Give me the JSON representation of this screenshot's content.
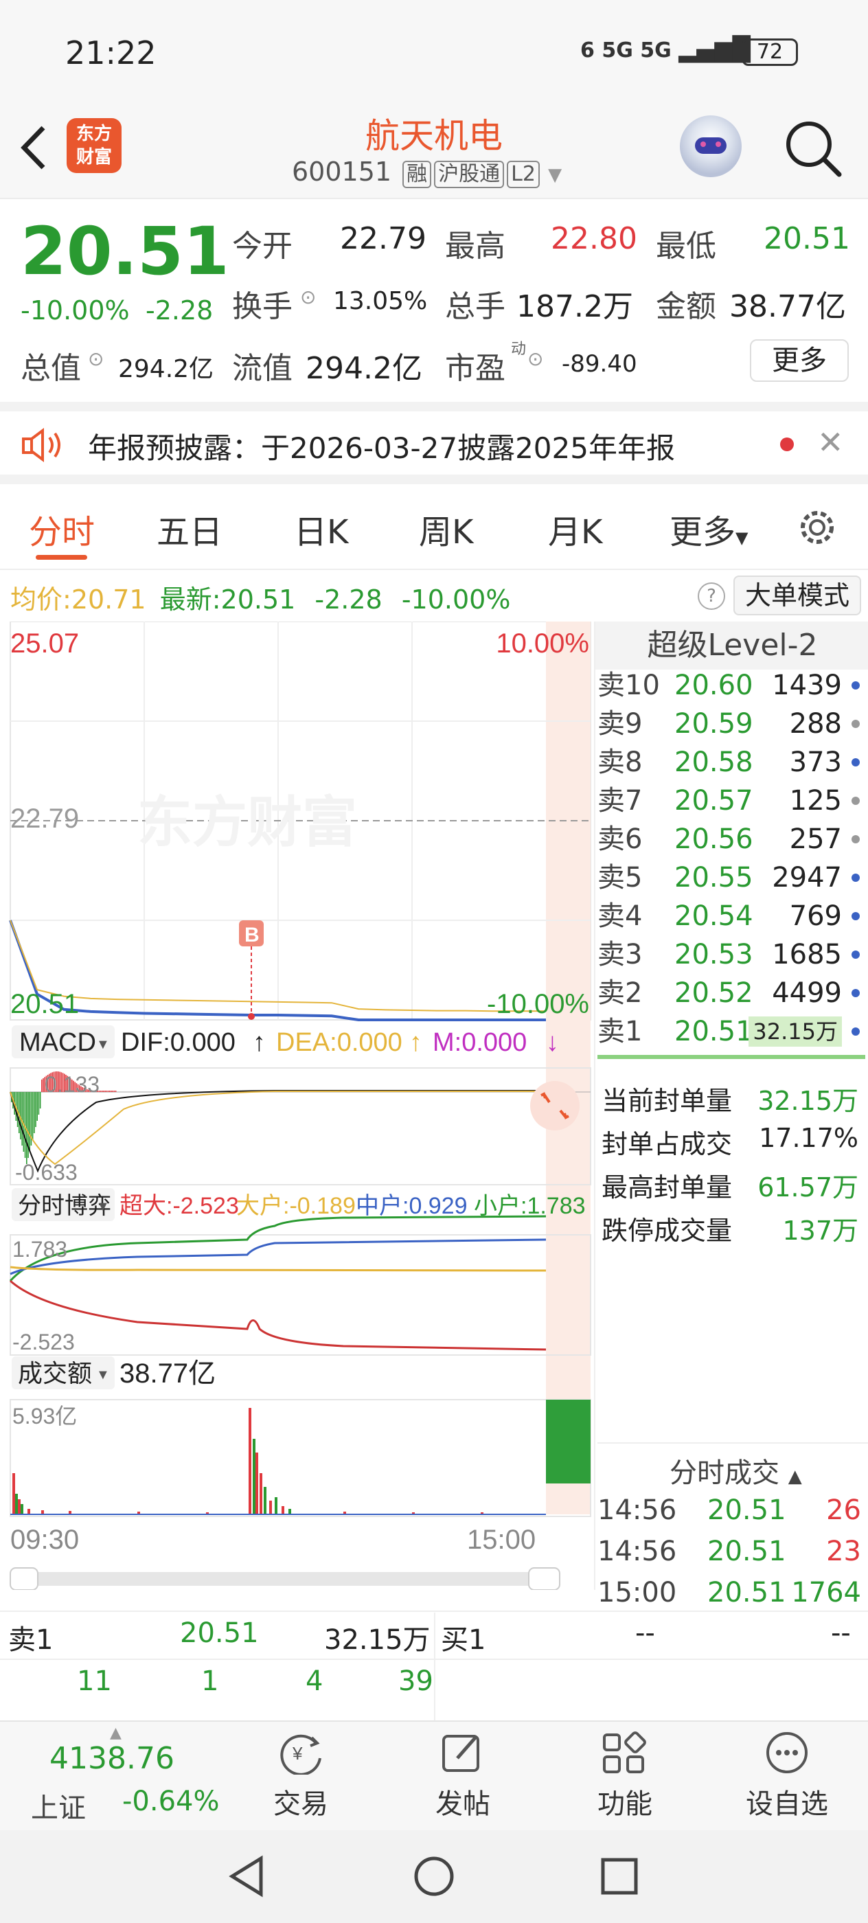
{
  "status": {
    "time": "21:22",
    "signal": "6 5G 5G",
    "battery": "72"
  },
  "header": {
    "title": "航天机电",
    "code": "600151",
    "tags": [
      "融",
      "沪股通",
      "L2"
    ]
  },
  "quote": {
    "price": "20.51",
    "pct": "-10.00%",
    "change": "-2.28",
    "open_label": "今开",
    "open": "22.79",
    "high_label": "最高",
    "high": "22.80",
    "low_label": "最低",
    "low": "20.51",
    "turnover_label": "换手",
    "turnover": "13.05%",
    "volume_label": "总手",
    "volume": "187.2万",
    "amount_label": "金额",
    "amount": "38.77亿",
    "mktcap_label": "总值",
    "mktcap": "294.2亿",
    "float_label": "流值",
    "float": "294.2亿",
    "pe_label": "市盈",
    "pe_sup": "动",
    "pe": "-89.40",
    "more_button": "更多"
  },
  "notice": {
    "text": "年报预披露：于2026-03-27披露2025年年报"
  },
  "tabs": [
    "分时",
    "五日",
    "日K",
    "周K",
    "月K",
    "更多"
  ],
  "chart_info": {
    "avg_label": "均价:",
    "avg": "20.71",
    "last_label": "最新:",
    "last": "20.51",
    "chg": "-2.28",
    "pct": "-10.00%",
    "mode_button": "大单模式"
  },
  "chart_data": [
    {
      "type": "line",
      "title": "",
      "y_top_label": "25.07",
      "y_ref_label": "22.79",
      "y_bottom_label": "20.51",
      "pct_top_label": "10.00%",
      "pct_bottom_label": "-10.00%",
      "ylim": [
        20.51,
        25.07
      ],
      "series": [
        {
          "values": [
            22.79,
            21.1,
            20.75,
            20.7,
            20.68,
            20.66,
            20.65,
            20.64,
            20.63,
            20.62,
            20.62,
            20.61,
            20.6,
            20.51,
            20.51,
            20.51,
            20.51,
            20.51,
            20.51,
            20.51,
            20.51
          ]
        },
        {
          "values": [
            22.79,
            21.2,
            21.05,
            21.0,
            20.98,
            20.97,
            20.96,
            20.95,
            20.94,
            20.93,
            20.92,
            20.91,
            20.9,
            20.76,
            20.74,
            20.73,
            20.72,
            20.72,
            20.71,
            20.71,
            20.71
          ]
        }
      ],
      "marker": "B",
      "xlabels": [
        "09:30",
        "15:00"
      ]
    },
    {
      "type": "bar",
      "title": "MACD",
      "dif_label": "DIF:0.000",
      "dea_label": "DEA:0.000",
      "m_label": "M:0.000",
      "y_top_label": "0.133",
      "y_bottom_label": "-0.633"
    },
    {
      "type": "line",
      "title": "分时博弈",
      "labels": [
        "超大:-2.523",
        "大户:-0.189",
        "中户:0.929",
        "小户:1.783"
      ],
      "y_top_label": "1.783",
      "y_bottom_label": "-2.523"
    },
    {
      "type": "bar",
      "title": "成交额",
      "total": "38.77亿",
      "y_top_label": "5.93亿",
      "xlabels": [
        "09:30",
        "15:00"
      ]
    }
  ],
  "level2": {
    "title": "超级Level-2",
    "asks": [
      {
        "label": "卖10",
        "price": "20.60",
        "vol": "1439"
      },
      {
        "label": "卖9",
        "price": "20.59",
        "vol": "288"
      },
      {
        "label": "卖8",
        "price": "20.58",
        "vol": "373"
      },
      {
        "label": "卖7",
        "price": "20.57",
        "vol": "125"
      },
      {
        "label": "卖6",
        "price": "20.56",
        "vol": "257"
      },
      {
        "label": "卖5",
        "price": "20.55",
        "vol": "2947"
      },
      {
        "label": "卖4",
        "price": "20.54",
        "vol": "769"
      },
      {
        "label": "卖3",
        "price": "20.53",
        "vol": "1685"
      },
      {
        "label": "卖2",
        "price": "20.52",
        "vol": "4499"
      },
      {
        "label": "卖1",
        "price": "20.51",
        "vol": "32.15万"
      }
    ],
    "stats": [
      {
        "label": "当前封单量",
        "value": "32.15万"
      },
      {
        "label": "封单占成交",
        "value": "17.17%"
      },
      {
        "label": "最高封单量",
        "value": "61.57万"
      },
      {
        "label": "跌停成交量",
        "value": "137万"
      }
    ],
    "trades_title": "分时成交",
    "trades": [
      {
        "time": "14:56",
        "price": "20.51",
        "vol": "26"
      },
      {
        "time": "14:56",
        "price": "20.51",
        "vol": "23"
      },
      {
        "time": "15:00",
        "price": "20.51",
        "vol": "1764"
      }
    ]
  },
  "bottom_book": {
    "sell_label": "卖1",
    "sell_price": "20.51",
    "sell_vol": "32.15万",
    "buy_label": "买1",
    "buy_price": "--",
    "buy_vol": "--",
    "queue": [
      "11",
      "1",
      "4",
      "39"
    ]
  },
  "bottom_nav": {
    "index_value": "4138.76",
    "index_name": "上证",
    "index_pct": "-0.64%",
    "items": [
      "交易",
      "发帖",
      "功能",
      "设自选"
    ]
  }
}
